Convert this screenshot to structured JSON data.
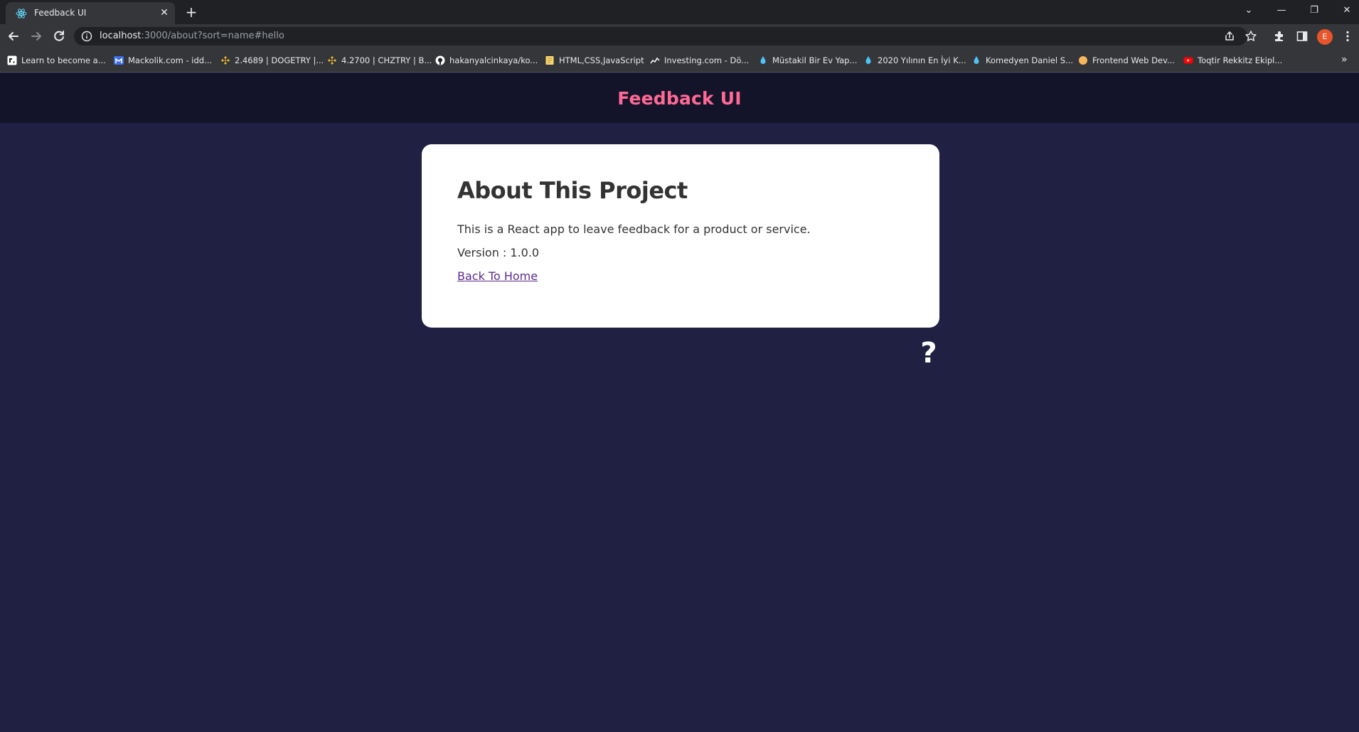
{
  "browser": {
    "tab": {
      "title": "Feedback UI",
      "icon": "react-atom-icon"
    },
    "url": {
      "host": "localhost",
      "rest": ":3000/about?sort=name#hello"
    },
    "bookmarks": [
      {
        "label": "Learn to become a...",
        "icon": "gear-square-icon",
        "color": "#ffffff"
      },
      {
        "label": "Mackolik.com - idd...",
        "icon": "m-logo-icon",
        "color": "#3b6ee8"
      },
      {
        "label": "2.4689 | DOGETRY |...",
        "icon": "binance-icon",
        "color": "#f3ba2f"
      },
      {
        "label": "4.2700 | CHZTRY | B...",
        "icon": "binance-icon",
        "color": "#f3ba2f"
      },
      {
        "label": "hakanyalcinkaya/ko...",
        "icon": "github-icon",
        "color": "#ffffff"
      },
      {
        "label": "HTML,CSS,JavaScript",
        "icon": "folder-note-icon",
        "color": "#f7d774"
      },
      {
        "label": "Investing.com - Dö...",
        "icon": "investing-icon",
        "color": "#ffffff"
      },
      {
        "label": "Müstakil Bir Ev Yap...",
        "icon": "drop-icon",
        "color": "#4fc3f7"
      },
      {
        "label": "2020 Yılının En İyi K...",
        "icon": "drop-icon",
        "color": "#4fc3f7"
      },
      {
        "label": "Komedyen Daniel S...",
        "icon": "drop-icon",
        "color": "#4fc3f7"
      },
      {
        "label": "Frontend Web Dev...",
        "icon": "circle-icon",
        "color": "#f6b65a"
      },
      {
        "label": "Toqtir Rekkitz Ekipl...",
        "icon": "youtube-icon",
        "color": "#ff0000"
      }
    ],
    "avatar_letter": "E"
  },
  "app": {
    "brand": "Feedback UI",
    "brand_color": "#ff6a95",
    "background": "#202142"
  },
  "about": {
    "title": "About This Project",
    "description": "This is a React app to leave feedback for a product or service.",
    "version": "Version : 1.0.0",
    "back_link": "Back To Home"
  },
  "about_icon": {
    "glyph": "?",
    "icon": "question-icon"
  }
}
